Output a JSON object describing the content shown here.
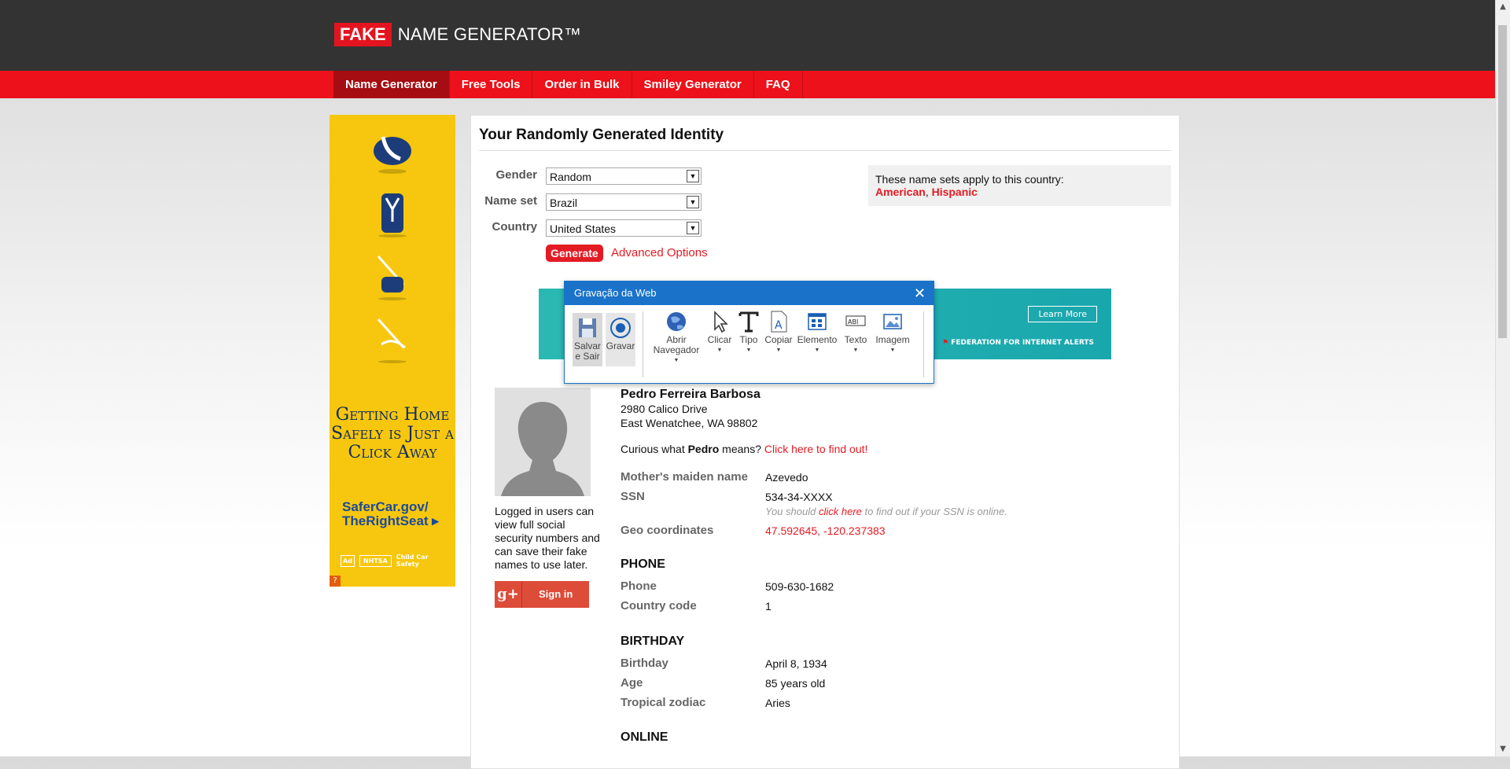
{
  "logo": {
    "fake": "FAKE",
    "rest": "NAME GENERATOR™"
  },
  "nav": [
    "Name Generator",
    "Free Tools",
    "Order in Bulk",
    "Smiley Generator",
    "FAQ"
  ],
  "ad": {
    "headline": "Getting Home Safely is Just a Click Away",
    "url": "SaferCar.gov/ TheRightSeat ▸",
    "q": "?"
  },
  "main": {
    "title": "Your Randomly Generated Identity",
    "form": {
      "gender_label": "Gender",
      "gender_value": "Random",
      "nameset_label": "Name set",
      "nameset_value": "Brazil",
      "country_label": "Country",
      "country_value": "United States",
      "generate": "Generate",
      "advanced": "Advanced Options"
    },
    "nameset_box": {
      "text": "These name sets apply to this country:",
      "set1": "American",
      "comma": ",",
      "set2": "Hispanic"
    },
    "banner": {
      "learn": "Learn More",
      "fed": "FEDERATION FOR INTERNET ALERTS"
    },
    "login_text": "Logged in users can view full social security numbers and can save their fake names to use later.",
    "signin": {
      "g": "g+",
      "label": "Sign in"
    },
    "identity": {
      "name": "Pedro Ferreira Barbosa",
      "address1": "2980 Calico Drive",
      "address2": "East Wenatchee, WA 98802",
      "curious_pre": "Curious what ",
      "curious_name": "Pedro",
      "curious_mid": " means? ",
      "curious_link": "Click here to find out!",
      "maiden_label": "Mother's maiden name",
      "maiden": "Azevedo",
      "ssn_label": "SSN",
      "ssn": "534-34-XXXX",
      "ssn_hint_pre": "You should ",
      "ssn_hint_link": "click here",
      "ssn_hint_post": " to find out if your SSN is online.",
      "geo_label": "Geo coordinates",
      "geo": "47.592645, -120.237383",
      "phone_section": "PHONE",
      "phone_label": "Phone",
      "phone": "509-630-1682",
      "cc_label": "Country code",
      "cc": "1",
      "birthday_section": "BIRTHDAY",
      "birthday_label": "Birthday",
      "birthday": "April 8, 1934",
      "age_label": "Age",
      "age": "85 years old",
      "zodiac_label": "Tropical zodiac",
      "zodiac": "Aries",
      "online_section": "ONLINE"
    }
  },
  "popup": {
    "title": "Gravação da Web",
    "close": "✕",
    "tools": [
      {
        "label": "Salvar e Sair",
        "icon": "save-icon"
      },
      {
        "label": "Gravar",
        "icon": "record-icon"
      },
      {
        "label": "Abrir Navegador",
        "icon": "globe-icon"
      },
      {
        "label": "Clicar",
        "icon": "cursor-icon"
      },
      {
        "label": "Tipo",
        "icon": "text-type-icon"
      },
      {
        "label": "Copiar",
        "icon": "copy-icon"
      },
      {
        "label": "Elemento",
        "icon": "element-icon"
      },
      {
        "label": "Texto",
        "icon": "text-field-icon"
      },
      {
        "label": "Imagem",
        "icon": "image-icon"
      }
    ]
  },
  "colors": {
    "brand_red": "#ec111a",
    "dark_header": "#333333",
    "popup_blue": "#1a73c9",
    "ad_yellow": "#f7c70f"
  }
}
